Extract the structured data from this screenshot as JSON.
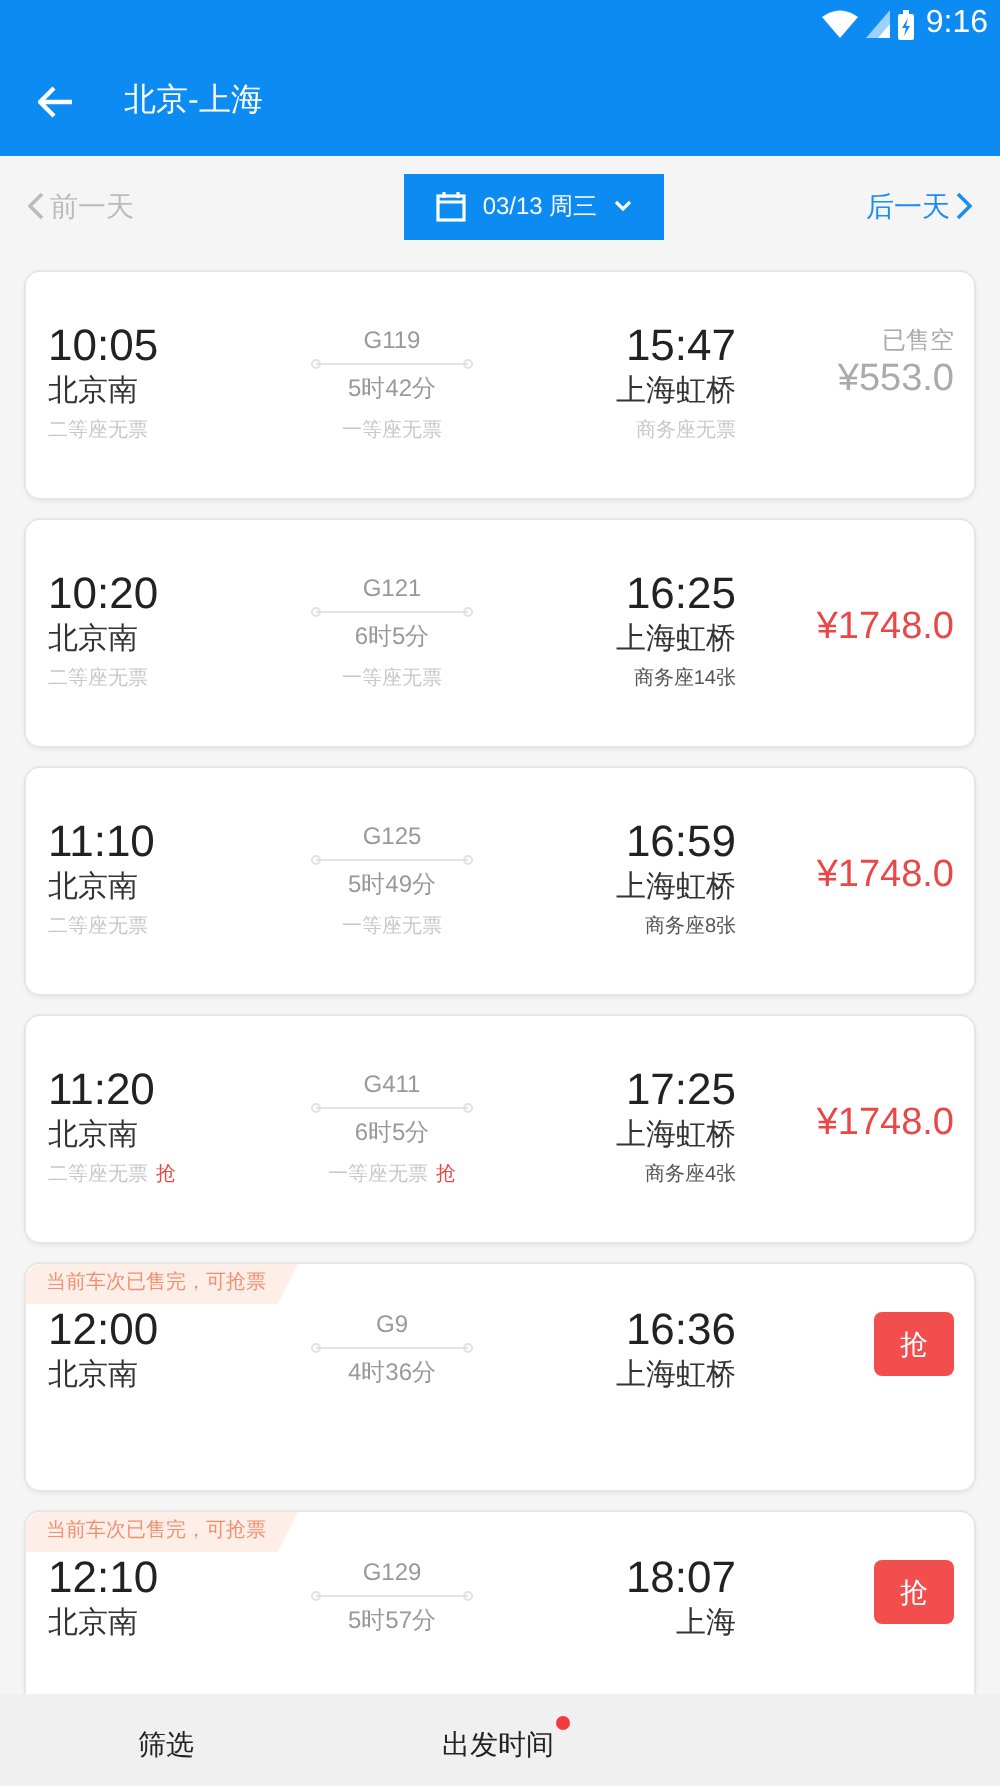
{
  "status_bar": {
    "time": "9:16"
  },
  "header": {
    "title": "北京-上海"
  },
  "date_nav": {
    "prev": "前一天",
    "prev_disabled": true,
    "date": "03/13 周三",
    "next": "后一天",
    "next_disabled": false
  },
  "trains": [
    {
      "kind": "price",
      "depart": "10:05",
      "from": "北京南",
      "train": "G119",
      "duration": "5时42分",
      "arrive": "15:47",
      "to": "上海虹桥",
      "seats": [
        {
          "text": "二等座无票",
          "available": false
        },
        {
          "text": "一等座无票",
          "available": false
        },
        {
          "text": "商务座无票",
          "available": false
        }
      ],
      "status": "已售空",
      "price": "¥553.0",
      "sold_out": true
    },
    {
      "kind": "price",
      "depart": "10:20",
      "from": "北京南",
      "train": "G121",
      "duration": "6时5分",
      "arrive": "16:25",
      "to": "上海虹桥",
      "seats": [
        {
          "text": "二等座无票",
          "available": false
        },
        {
          "text": "一等座无票",
          "available": false
        },
        {
          "text": "商务座14张",
          "available": true
        }
      ],
      "price": "¥1748.0",
      "sold_out": false
    },
    {
      "kind": "price",
      "depart": "11:10",
      "from": "北京南",
      "train": "G125",
      "duration": "5时49分",
      "arrive": "16:59",
      "to": "上海虹桥",
      "seats": [
        {
          "text": "二等座无票",
          "available": false
        },
        {
          "text": "一等座无票",
          "available": false
        },
        {
          "text": "商务座8张",
          "available": true
        }
      ],
      "price": "¥1748.0",
      "sold_out": false
    },
    {
      "kind": "price",
      "depart": "11:20",
      "from": "北京南",
      "train": "G411",
      "duration": "6时5分",
      "arrive": "17:25",
      "to": "上海虹桥",
      "seats": [
        {
          "text": "二等座无票",
          "available": false,
          "grab": "抢"
        },
        {
          "text": "一等座无票",
          "available": false,
          "grab": "抢"
        },
        {
          "text": "商务座4张",
          "available": true
        }
      ],
      "price": "¥1748.0",
      "sold_out": false
    },
    {
      "kind": "rush",
      "banner": "当前车次已售完，可抢票",
      "depart": "12:00",
      "from": "北京南",
      "train": "G9",
      "duration": "4时36分",
      "arrive": "16:36",
      "to": "上海虹桥",
      "button": "抢"
    },
    {
      "kind": "rush",
      "banner": "当前车次已售完，可抢票",
      "depart": "12:10",
      "from": "北京南",
      "train": "G129",
      "duration": "5时57分",
      "arrive": "18:07",
      "to": "上海",
      "button": "抢"
    }
  ],
  "bottom_bar": [
    {
      "label": "筛选",
      "dot": false
    },
    {
      "label": "出发时间",
      "dot": true
    }
  ]
}
